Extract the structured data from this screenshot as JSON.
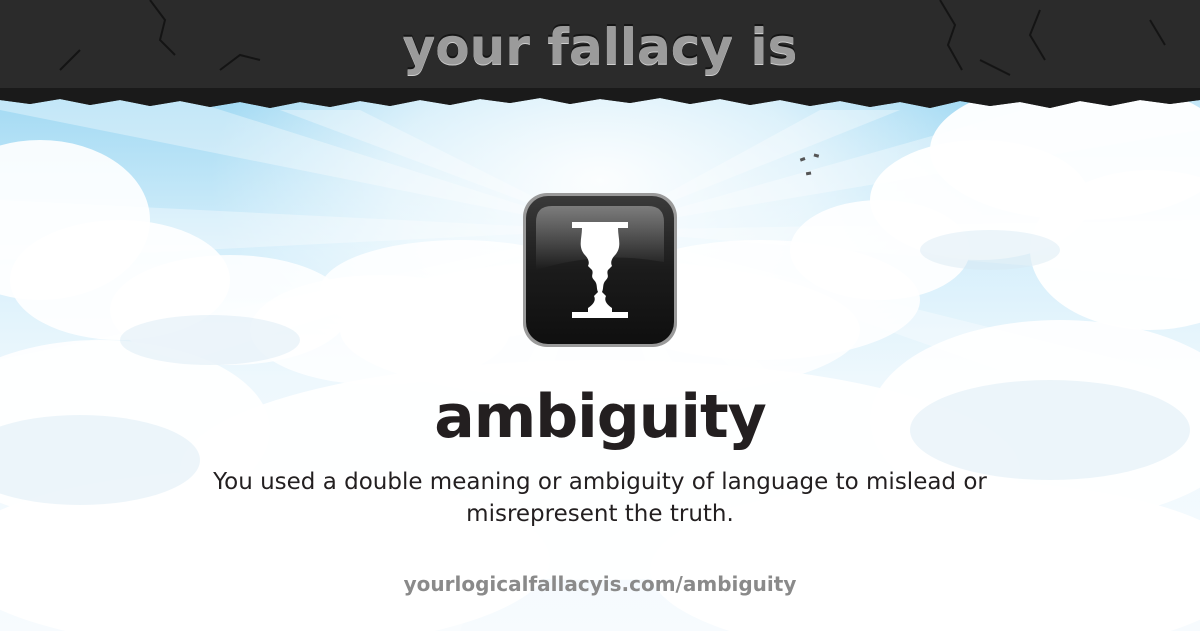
{
  "header": {
    "title": "your fallacy is"
  },
  "fallacy": {
    "icon": "rubin-vase-faces-icon",
    "name": "ambiguity",
    "description": "You used a double meaning or ambiguity of language to mislead or misrepresent the truth."
  },
  "footer": {
    "url": "yourlogicalfallacyis.com/ambiguity"
  },
  "colors": {
    "header_bar": "#2b2b2b",
    "header_text": "#9b9b9b",
    "sky_top": "#7fcbee",
    "sky_bottom": "#f7fbfe",
    "title_text": "#231f20",
    "url_text": "#8a8a8a",
    "icon_bg": "#1e1e1e"
  }
}
